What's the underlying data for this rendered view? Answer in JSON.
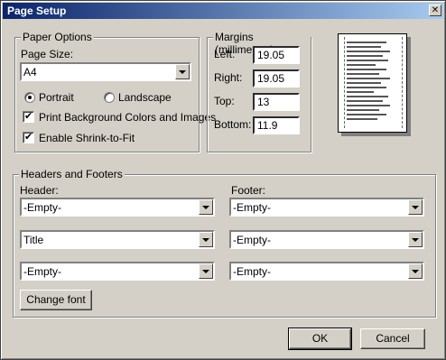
{
  "window": {
    "title": "Page Setup",
    "close_symbol": "✕"
  },
  "paper_options": {
    "legend": "Paper Options",
    "page_size_label": "Page Size:",
    "page_size_value": "A4",
    "portrait_label": "Portrait",
    "landscape_label": "Landscape",
    "orientation_selected": "Portrait",
    "print_background_label": "Print Background Colors and Images",
    "print_background_checked": true,
    "shrink_to_fit_label": "Enable Shrink-to-Fit",
    "shrink_to_fit_checked": true
  },
  "margins": {
    "legend": "Margins (millimeters)",
    "left_label": "Left:",
    "left_value": "19.05",
    "right_label": "Right:",
    "right_value": "19.05",
    "top_label": "Top:",
    "top_value": "13",
    "bottom_label": "Bottom:",
    "bottom_value": "11.9"
  },
  "headers_footers": {
    "legend": "Headers and Footers",
    "header_label": "Header:",
    "footer_label": "Footer:",
    "header_values": [
      "-Empty-",
      "Title",
      "-Empty-"
    ],
    "footer_values": [
      "-Empty-",
      "-Empty-",
      "-Empty-"
    ],
    "change_font_label": "Change font"
  },
  "buttons": {
    "ok": "OK",
    "cancel": "Cancel"
  },
  "icons": {
    "combo_arrow": "chevron-down-icon",
    "close": "close-icon"
  }
}
